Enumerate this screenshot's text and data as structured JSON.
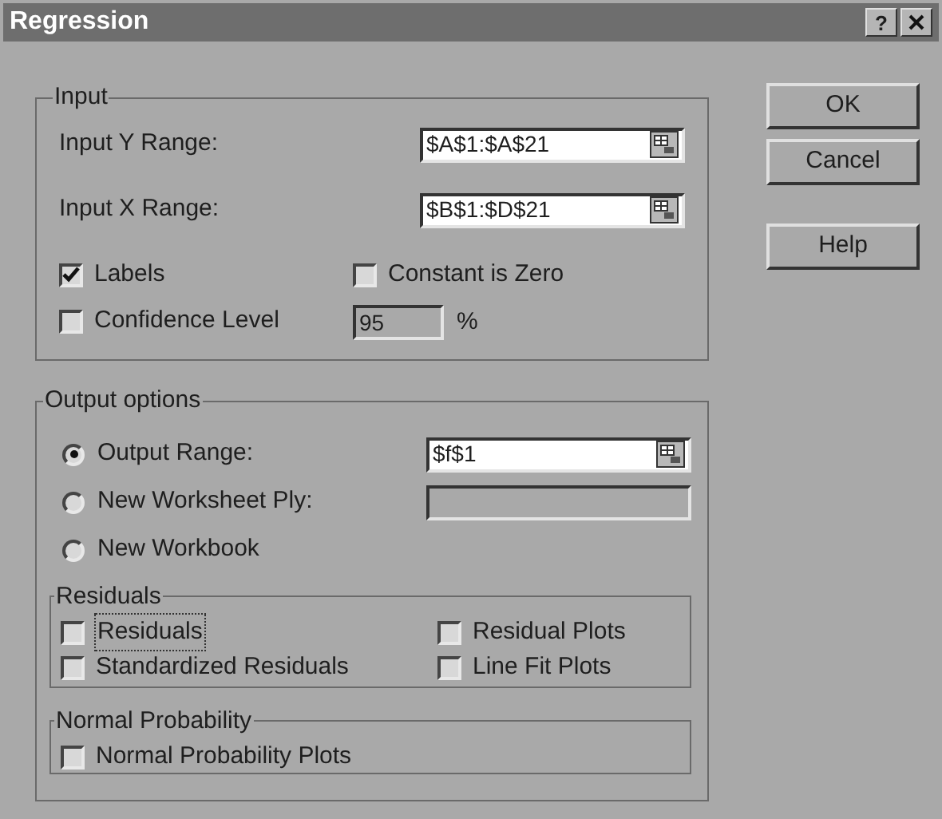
{
  "window": {
    "title": "Regression",
    "help_button": "?"
  },
  "input": {
    "label": "Input",
    "fields": [
      {
        "label": "Input Y Range:",
        "value": "$A$1:$A$21"
      },
      {
        "label": "Input X Range:",
        "value": "$B$1:$D$21"
      }
    ],
    "options": [
      {
        "label": "Labels",
        "checked": true
      },
      {
        "label": "Constant is Zero",
        "checked": false
      },
      {
        "label": "Confidence Level",
        "checked": false
      }
    ],
    "confidence": {
      "value": "95",
      "unit": "%"
    }
  },
  "output": {
    "label": "Output options",
    "destinations": [
      {
        "label": "Output Range:",
        "selected": true,
        "kind": "range",
        "value": "$f$1"
      },
      {
        "label": "New Worksheet Ply:",
        "selected": false,
        "kind": "text"
      },
      {
        "label": "New Workbook",
        "selected": false,
        "kind": "none"
      }
    ],
    "residuals": {
      "label": "Residuals",
      "options": [
        {
          "label": "Residuals",
          "checked": false,
          "focused": true
        },
        {
          "label": "Residual Plots",
          "checked": false,
          "focused": false
        },
        {
          "label": "Standardized Residuals",
          "checked": false,
          "focused": false
        },
        {
          "label": "Line Fit Plots",
          "checked": false,
          "focused": false
        }
      ]
    },
    "normal_probability": {
      "label": "Normal Probability",
      "options": [
        {
          "label": "Normal Probability Plots",
          "checked": false
        }
      ]
    }
  },
  "buttons": [
    {
      "label": "OK"
    },
    {
      "label": "Cancel"
    },
    {
      "label": "Help"
    }
  ]
}
